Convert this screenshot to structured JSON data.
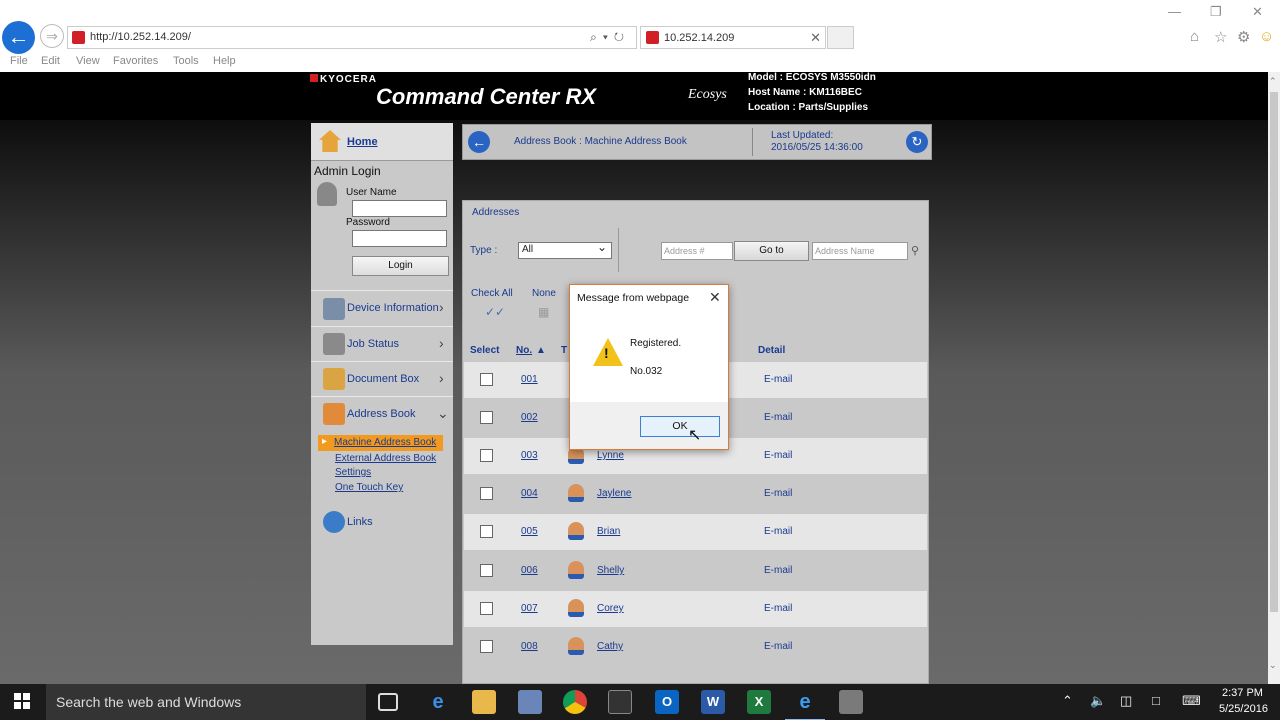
{
  "browser": {
    "url": "http://10.252.14.209/",
    "tab_title": "10.252.14.209",
    "menu": [
      "File",
      "Edit",
      "View",
      "Favorites",
      "Tools",
      "Help"
    ]
  },
  "header": {
    "brand": "KYOCERA",
    "product": "Command Center RX",
    "edition": "Ecosys",
    "model": "Model : ECOSYS M3550idn",
    "host": "Host Name : KM116BEC",
    "location": "Location : Parts/Supplies"
  },
  "sidebar": {
    "home": "Home",
    "admin_login": "Admin Login",
    "user_name_label": "User Name",
    "password_label": "Password",
    "login_button": "Login",
    "nav": [
      "Device Information",
      "Job Status",
      "Document Box",
      "Address Book",
      "Links"
    ],
    "address_book_sub": [
      "Machine Address Book",
      "External Address Book",
      "Settings",
      "One Touch Key"
    ]
  },
  "topbar": {
    "breadcrumb": "Address Book : Machine Address Book",
    "last_updated_label": "Last Updated:",
    "last_updated_value": "2016/05/25 14:36:00"
  },
  "panel": {
    "heading": "Addresses",
    "type_label": "Type :",
    "type_value": "All",
    "address_no_placeholder": "Address #",
    "goto_button": "Go to",
    "address_name_placeholder": "Address Name",
    "check_all": "Check All",
    "none": "None",
    "columns": {
      "select": "Select",
      "no": "No.",
      "type": "T",
      "detail": "Detail"
    },
    "rows": [
      {
        "no": "001",
        "name": "",
        "detail": "E-mail"
      },
      {
        "no": "002",
        "name": "",
        "detail": "E-mail"
      },
      {
        "no": "003",
        "name": "Lynne",
        "detail": "E-mail"
      },
      {
        "no": "004",
        "name": "Jaylene",
        "detail": "E-mail"
      },
      {
        "no": "005",
        "name": "Brian",
        "detail": "E-mail"
      },
      {
        "no": "006",
        "name": "Shelly",
        "detail": "E-mail"
      },
      {
        "no": "007",
        "name": "Corey",
        "detail": "E-mail"
      },
      {
        "no": "008",
        "name": "Cathy",
        "detail": "E-mail"
      }
    ]
  },
  "dialog": {
    "title": "Message from webpage",
    "message_line1": "Registered.",
    "message_line2": "No.032",
    "ok_button": "OK"
  },
  "taskbar": {
    "search_placeholder": "Search the web and Windows",
    "time": "2:37 PM",
    "date": "5/25/2016"
  },
  "colors": {
    "accent_orange": "#f29a20",
    "link_blue": "#1a3a8f",
    "windows_blue": "#1e6fd3"
  }
}
